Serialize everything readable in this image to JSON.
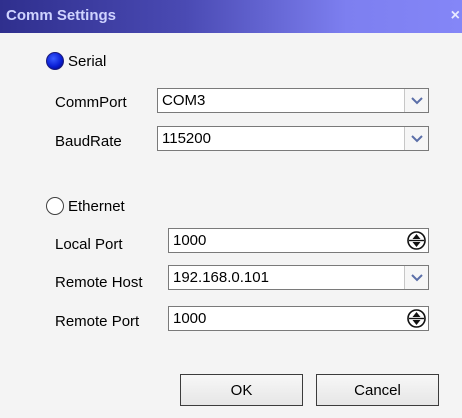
{
  "window": {
    "title": "Comm Settings",
    "close_glyph": "×"
  },
  "serial": {
    "label": "Serial",
    "selected": true,
    "commport": {
      "label": "CommPort",
      "value": "COM3"
    },
    "baudrate": {
      "label": "BaudRate",
      "value": "115200"
    }
  },
  "ethernet": {
    "label": "Ethernet",
    "selected": false,
    "local_port": {
      "label": "Local Port",
      "value": "1000"
    },
    "remote_host": {
      "label": "Remote Host",
      "value": "192.168.0.101"
    },
    "remote_port": {
      "label": "Remote Port",
      "value": "1000"
    }
  },
  "buttons": {
    "ok": "OK",
    "cancel": "Cancel"
  },
  "colors": {
    "title_gradient_start": "#2f2f8e",
    "title_gradient_end": "#8486f7",
    "radio_selected": "#0a1fd6"
  },
  "icons": {
    "dropdown": "chevron-down-icon",
    "spin": "spin-updown-icon"
  }
}
